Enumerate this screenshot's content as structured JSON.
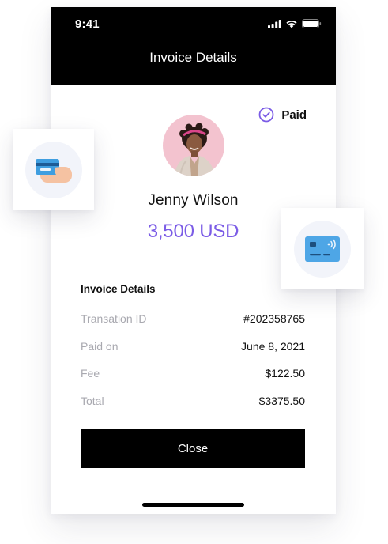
{
  "status_bar": {
    "time": "9:41",
    "icons": [
      "cellular-signal-icon",
      "wifi-icon",
      "battery-icon"
    ]
  },
  "header": {
    "title": "Invoice Details"
  },
  "payment": {
    "status_label": "Paid",
    "status_icon": "check-circle-icon",
    "payer_name": "Jenny Wilson",
    "amount": "3,500 USD"
  },
  "details": {
    "section_title": "Invoice Details",
    "rows": [
      {
        "label": "Transation ID",
        "value": "#202358765"
      },
      {
        "label": "Paid on",
        "value": "June 8, 2021"
      },
      {
        "label": "Fee",
        "value": "$122.50"
      },
      {
        "label": "Total",
        "value": "$3375.50"
      }
    ]
  },
  "actions": {
    "close_label": "Close"
  },
  "floating_cards": [
    {
      "icon": "hand-holding-card-icon"
    },
    {
      "icon": "contactless-card-icon"
    }
  ],
  "colors": {
    "accent": "#7b5ce6",
    "header_bg": "#000000",
    "button_bg": "#000000",
    "label_gray": "#a9a9b0"
  }
}
